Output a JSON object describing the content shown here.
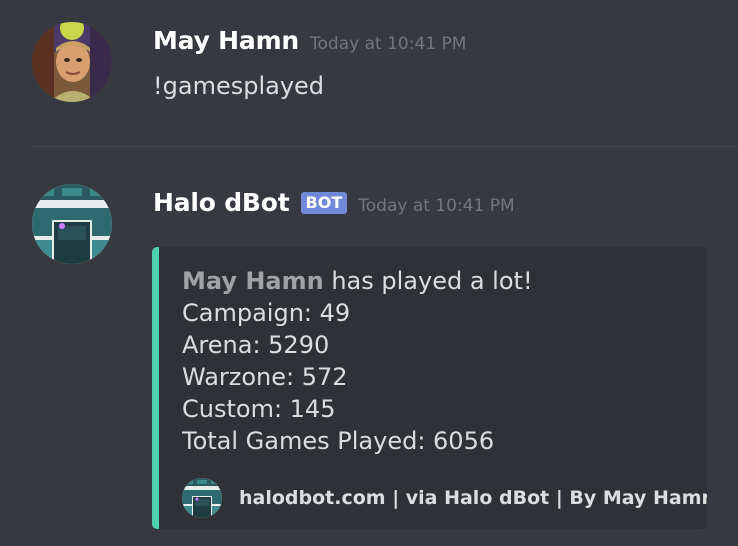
{
  "colors": {
    "background": "#36393f",
    "embed_bg": "#2f3136",
    "embed_accent": "#4fd1b0",
    "bot_tag": "#7289da",
    "username": "#ffffff",
    "timestamp": "#72767d",
    "text": "#dcddde"
  },
  "messages": [
    {
      "author": "May Hamn",
      "avatar_icon": "user-avatar",
      "timestamp": "Today at 10:41 PM",
      "content": "!gamesplayed"
    },
    {
      "author": "Halo dBot",
      "avatar_icon": "bot-avatar",
      "bot_tag": "BOT",
      "timestamp": "Today at 10:41 PM",
      "embed": {
        "description": {
          "bold_name": "May Hamn",
          "headline_rest": " has played a lot!",
          "lines": [
            "Campaign: 49",
            "Arena: 5290",
            "Warzone: 572",
            "Custom: 145",
            "Total Games Played: 6056"
          ]
        },
        "footer": {
          "icon": "bot-avatar",
          "text": "halodbot.com | via Halo dBot | By May Hamn"
        }
      }
    }
  ]
}
